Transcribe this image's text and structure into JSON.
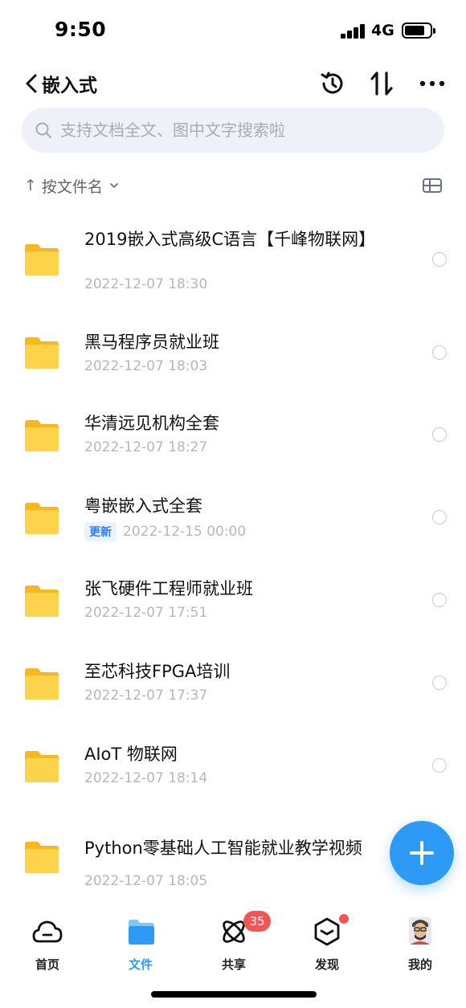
{
  "status_bar": {
    "time": "9:50",
    "network": "4G"
  },
  "header": {
    "title": "嵌入式",
    "icons": [
      "back-chevron-icon",
      "history-icon",
      "sort-icon",
      "more-icon"
    ]
  },
  "search": {
    "placeholder": "支持文档全文、图中文字搜索啦",
    "value": ""
  },
  "sort": {
    "label": "按文件名",
    "direction_glyph": "↑"
  },
  "files": [
    {
      "name": "2019嵌入式高级C语言【千峰物联网】",
      "date": "2022-12-07 18:30"
    },
    {
      "name": "黑马程序员就业班",
      "date": "2022-12-07 18:03"
    },
    {
      "name": "华清远见机构全套",
      "date": "2022-12-07 18:27"
    },
    {
      "name": "粤嵌嵌入式全套",
      "date": "2022-12-15 00:00",
      "badge": "更新"
    },
    {
      "name": "张飞硬件工程师就业班",
      "date": "2022-12-07 17:51"
    },
    {
      "name": "至芯科技FPGA培训",
      "date": "2022-12-07 17:37"
    },
    {
      "name": "AIoT 物联网",
      "date": "2022-12-07 18:14"
    },
    {
      "name": "Python零基础人工智能就业教学视频",
      "date": "2022-12-07 18:05"
    }
  ],
  "tabs": [
    {
      "label": "首页",
      "icon": "cloud-icon"
    },
    {
      "label": "文件",
      "icon": "folder-icon",
      "active": true
    },
    {
      "label": "共享",
      "icon": "atom-icon",
      "badge": "35"
    },
    {
      "label": "发现",
      "icon": "cube-icon",
      "dot": true
    },
    {
      "label": "我的",
      "icon": "avatar"
    }
  ],
  "colors": {
    "accent": "#2d9bf5",
    "folder": "#fcc936",
    "badge_red": "#f25555",
    "muted_text": "#b3b7c1"
  }
}
